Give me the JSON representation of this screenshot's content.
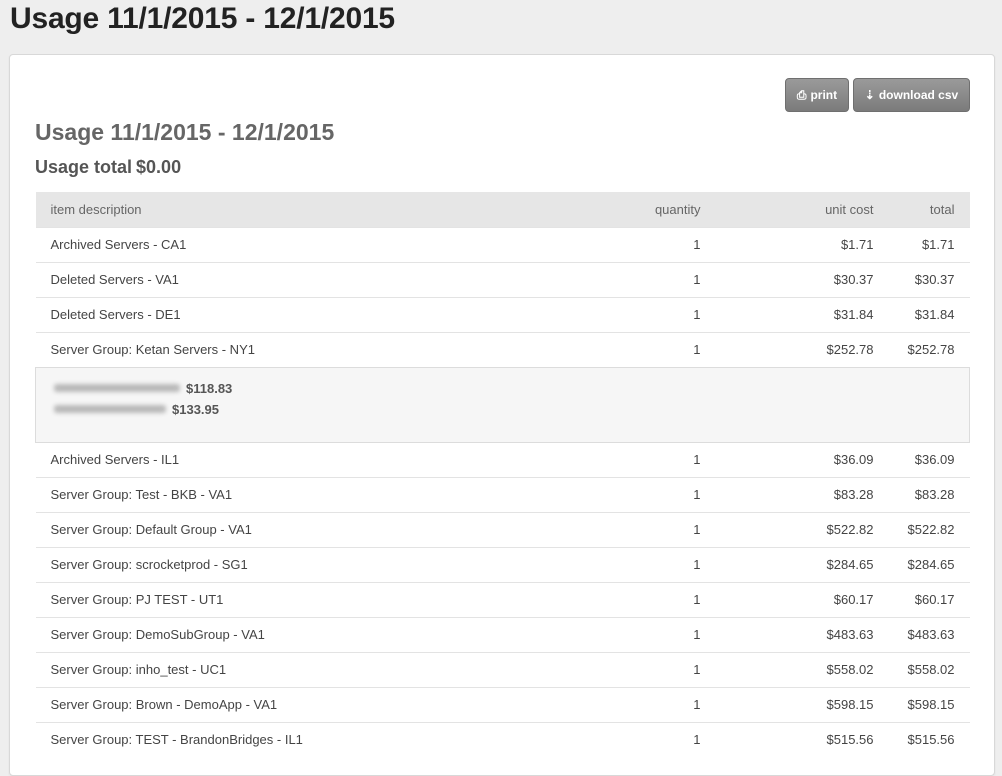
{
  "page": {
    "title": "Usage 11/1/2015 - 12/1/2015"
  },
  "toolbar": {
    "print_label": "print",
    "print_icon": "printer-icon",
    "csv_label": "download csv",
    "csv_icon": "download-icon"
  },
  "report": {
    "heading": "Usage 11/1/2015 - 12/1/2015",
    "total_label": "Usage total",
    "total_value": "$0.00"
  },
  "table": {
    "headers": {
      "description": "item description",
      "quantity": "quantity",
      "unit_cost": "unit cost",
      "total": "total"
    },
    "rows_before": [
      {
        "description": "Archived Servers - CA1",
        "quantity": "1",
        "unit_cost": "$1.71",
        "total": "$1.71"
      },
      {
        "description": "Deleted Servers - VA1",
        "quantity": "1",
        "unit_cost": "$30.37",
        "total": "$30.37"
      },
      {
        "description": "Deleted Servers - DE1",
        "quantity": "1",
        "unit_cost": "$31.84",
        "total": "$31.84"
      },
      {
        "description": "Server Group: Ketan Servers - NY1",
        "quantity": "1",
        "unit_cost": "$252.78",
        "total": "$252.78"
      }
    ],
    "detail": [
      {
        "value": "$118.83"
      },
      {
        "value": "$133.95"
      }
    ],
    "rows_after": [
      {
        "description": "Archived Servers - IL1",
        "quantity": "1",
        "unit_cost": "$36.09",
        "total": "$36.09"
      },
      {
        "description": "Server Group: Test - BKB - VA1",
        "quantity": "1",
        "unit_cost": "$83.28",
        "total": "$83.28"
      },
      {
        "description": "Server Group: Default Group - VA1",
        "quantity": "1",
        "unit_cost": "$522.82",
        "total": "$522.82"
      },
      {
        "description": "Server Group: scrocketprod - SG1",
        "quantity": "1",
        "unit_cost": "$284.65",
        "total": "$284.65"
      },
      {
        "description": "Server Group: PJ TEST - UT1",
        "quantity": "1",
        "unit_cost": "$60.17",
        "total": "$60.17"
      },
      {
        "description": "Server Group: DemoSubGroup - VA1",
        "quantity": "1",
        "unit_cost": "$483.63",
        "total": "$483.63"
      },
      {
        "description": "Server Group: inho_test - UC1",
        "quantity": "1",
        "unit_cost": "$558.02",
        "total": "$558.02"
      },
      {
        "description": "Server Group: Brown - DemoApp - VA1",
        "quantity": "1",
        "unit_cost": "$598.15",
        "total": "$598.15"
      },
      {
        "description": "Server Group: TEST - BrandonBridges - IL1",
        "quantity": "1",
        "unit_cost": "$515.56",
        "total": "$515.56"
      }
    ]
  }
}
